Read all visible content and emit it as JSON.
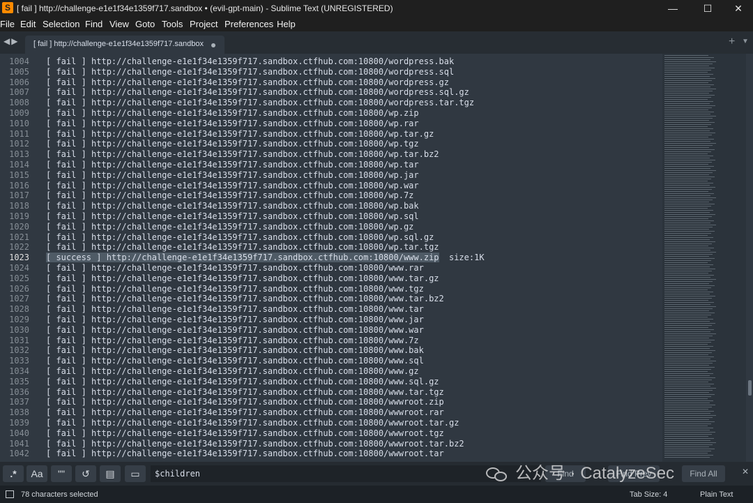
{
  "window": {
    "title": "[ fail ] http://challenge-e1e1f34e1359f717.sandbox • (evil-gpt-main) - Sublime Text (UNREGISTERED)",
    "minimize_icon": "minimize-icon",
    "maximize_icon": "maximize-icon",
    "close_icon": "close-icon"
  },
  "menu": [
    "File",
    "Edit",
    "Selection",
    "Find",
    "View",
    "Goto",
    "Tools",
    "Project",
    "Preferences",
    "Help"
  ],
  "tab": {
    "label": "[ fail ] http://challenge-e1e1f34e1359f717.sandbox"
  },
  "editor": {
    "current_line": "1023",
    "lines": [
      {
        "n": "1004",
        "text": "[ fail ] http://challenge-e1e1f34e1359f717.sandbox.ctfhub.com:10800/wordpress.bak"
      },
      {
        "n": "1005",
        "text": "[ fail ] http://challenge-e1e1f34e1359f717.sandbox.ctfhub.com:10800/wordpress.sql"
      },
      {
        "n": "1006",
        "text": "[ fail ] http://challenge-e1e1f34e1359f717.sandbox.ctfhub.com:10800/wordpress.gz"
      },
      {
        "n": "1007",
        "text": "[ fail ] http://challenge-e1e1f34e1359f717.sandbox.ctfhub.com:10800/wordpress.sql.gz"
      },
      {
        "n": "1008",
        "text": "[ fail ] http://challenge-e1e1f34e1359f717.sandbox.ctfhub.com:10800/wordpress.tar.tgz"
      },
      {
        "n": "1009",
        "text": "[ fail ] http://challenge-e1e1f34e1359f717.sandbox.ctfhub.com:10800/wp.zip"
      },
      {
        "n": "1010",
        "text": "[ fail ] http://challenge-e1e1f34e1359f717.sandbox.ctfhub.com:10800/wp.rar"
      },
      {
        "n": "1011",
        "text": "[ fail ] http://challenge-e1e1f34e1359f717.sandbox.ctfhub.com:10800/wp.tar.gz"
      },
      {
        "n": "1012",
        "text": "[ fail ] http://challenge-e1e1f34e1359f717.sandbox.ctfhub.com:10800/wp.tgz"
      },
      {
        "n": "1013",
        "text": "[ fail ] http://challenge-e1e1f34e1359f717.sandbox.ctfhub.com:10800/wp.tar.bz2"
      },
      {
        "n": "1014",
        "text": "[ fail ] http://challenge-e1e1f34e1359f717.sandbox.ctfhub.com:10800/wp.tar"
      },
      {
        "n": "1015",
        "text": "[ fail ] http://challenge-e1e1f34e1359f717.sandbox.ctfhub.com:10800/wp.jar"
      },
      {
        "n": "1016",
        "text": "[ fail ] http://challenge-e1e1f34e1359f717.sandbox.ctfhub.com:10800/wp.war"
      },
      {
        "n": "1017",
        "text": "[ fail ] http://challenge-e1e1f34e1359f717.sandbox.ctfhub.com:10800/wp.7z"
      },
      {
        "n": "1018",
        "text": "[ fail ] http://challenge-e1e1f34e1359f717.sandbox.ctfhub.com:10800/wp.bak"
      },
      {
        "n": "1019",
        "text": "[ fail ] http://challenge-e1e1f34e1359f717.sandbox.ctfhub.com:10800/wp.sql"
      },
      {
        "n": "1020",
        "text": "[ fail ] http://challenge-e1e1f34e1359f717.sandbox.ctfhub.com:10800/wp.gz"
      },
      {
        "n": "1021",
        "text": "[ fail ] http://challenge-e1e1f34e1359f717.sandbox.ctfhub.com:10800/wp.sql.gz"
      },
      {
        "n": "1022",
        "text": "[ fail ] http://challenge-e1e1f34e1359f717.sandbox.ctfhub.com:10800/wp.tar.tgz"
      },
      {
        "n": "1023",
        "text": "[ success ] http://challenge-e1e1f34e1359f717.sandbox.ctfhub.com:10800/www.zip  size:1K"
      },
      {
        "n": "1024",
        "text": "[ fail ] http://challenge-e1e1f34e1359f717.sandbox.ctfhub.com:10800/www.rar"
      },
      {
        "n": "1025",
        "text": "[ fail ] http://challenge-e1e1f34e1359f717.sandbox.ctfhub.com:10800/www.tar.gz"
      },
      {
        "n": "1026",
        "text": "[ fail ] http://challenge-e1e1f34e1359f717.sandbox.ctfhub.com:10800/www.tgz"
      },
      {
        "n": "1027",
        "text": "[ fail ] http://challenge-e1e1f34e1359f717.sandbox.ctfhub.com:10800/www.tar.bz2"
      },
      {
        "n": "1028",
        "text": "[ fail ] http://challenge-e1e1f34e1359f717.sandbox.ctfhub.com:10800/www.tar"
      },
      {
        "n": "1029",
        "text": "[ fail ] http://challenge-e1e1f34e1359f717.sandbox.ctfhub.com:10800/www.jar"
      },
      {
        "n": "1030",
        "text": "[ fail ] http://challenge-e1e1f34e1359f717.sandbox.ctfhub.com:10800/www.war"
      },
      {
        "n": "1031",
        "text": "[ fail ] http://challenge-e1e1f34e1359f717.sandbox.ctfhub.com:10800/www.7z"
      },
      {
        "n": "1032",
        "text": "[ fail ] http://challenge-e1e1f34e1359f717.sandbox.ctfhub.com:10800/www.bak"
      },
      {
        "n": "1033",
        "text": "[ fail ] http://challenge-e1e1f34e1359f717.sandbox.ctfhub.com:10800/www.sql"
      },
      {
        "n": "1034",
        "text": "[ fail ] http://challenge-e1e1f34e1359f717.sandbox.ctfhub.com:10800/www.gz"
      },
      {
        "n": "1035",
        "text": "[ fail ] http://challenge-e1e1f34e1359f717.sandbox.ctfhub.com:10800/www.sql.gz"
      },
      {
        "n": "1036",
        "text": "[ fail ] http://challenge-e1e1f34e1359f717.sandbox.ctfhub.com:10800/www.tar.tgz"
      },
      {
        "n": "1037",
        "text": "[ fail ] http://challenge-e1e1f34e1359f717.sandbox.ctfhub.com:10800/wwwroot.zip"
      },
      {
        "n": "1038",
        "text": "[ fail ] http://challenge-e1e1f34e1359f717.sandbox.ctfhub.com:10800/wwwroot.rar"
      },
      {
        "n": "1039",
        "text": "[ fail ] http://challenge-e1e1f34e1359f717.sandbox.ctfhub.com:10800/wwwroot.tar.gz"
      },
      {
        "n": "1040",
        "text": "[ fail ] http://challenge-e1e1f34e1359f717.sandbox.ctfhub.com:10800/wwwroot.tgz"
      },
      {
        "n": "1041",
        "text": "[ fail ] http://challenge-e1e1f34e1359f717.sandbox.ctfhub.com:10800/wwwroot.tar.bz2"
      },
      {
        "n": "1042",
        "text": "[ fail ] http://challenge-e1e1f34e1359f717.sandbox.ctfhub.com:10800/wwwroot.tar"
      }
    ]
  },
  "find_panel": {
    "regex_label": ".*",
    "case_label": "Aa",
    "word_label": "\"\"",
    "wrap_icon": "wrap-icon",
    "in_selection_icon": "in-selection-icon",
    "highlight_icon": "highlight-icon",
    "query": "$children",
    "find_label": "Find",
    "find_prev_label": "Find Prev",
    "find_all_label": "Find All"
  },
  "watermark": {
    "text": "公众号 · CatalyzeSec",
    "icon": "wechat-icon"
  },
  "status": {
    "selection": "78 characters selected",
    "tab_size": "Tab Size: 4",
    "syntax": "Plain Text"
  },
  "colors": {
    "editor_bg": "#303841",
    "text": "#d8dee9",
    "gutter_text": "#868e96",
    "selection": "#4f5b66",
    "chrome_bg": "#1f1f1f",
    "accent": "#ff8a00"
  }
}
